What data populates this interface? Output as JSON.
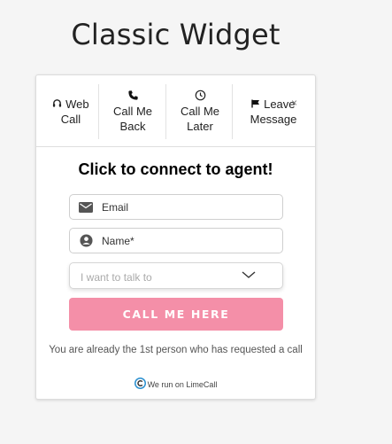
{
  "page": {
    "title": "Classic Widget"
  },
  "tabs": [
    {
      "icon": "headset-icon",
      "line1": "Web",
      "line2": "Call"
    },
    {
      "icon": "phone-icon",
      "line1": "Call Me",
      "line2": "Back"
    },
    {
      "icon": "clock-icon",
      "line1": "Call Me",
      "line2": "Later"
    },
    {
      "icon": "message-flag-icon",
      "line1": "Leave",
      "line2": "Message"
    }
  ],
  "close_glyph": "×",
  "form": {
    "headline": "Click to connect to agent!",
    "email_label": "Email",
    "name_label": "Name*",
    "topic_placeholder": "I want to talk to",
    "submit_label": "CALL ME HERE"
  },
  "info_text": "You are already the 1st person who has requested a call",
  "powered_by": "We run on LimeCall",
  "colors": {
    "button_bg": "#f48fa8",
    "brand_icon": "#2a8fcf"
  }
}
